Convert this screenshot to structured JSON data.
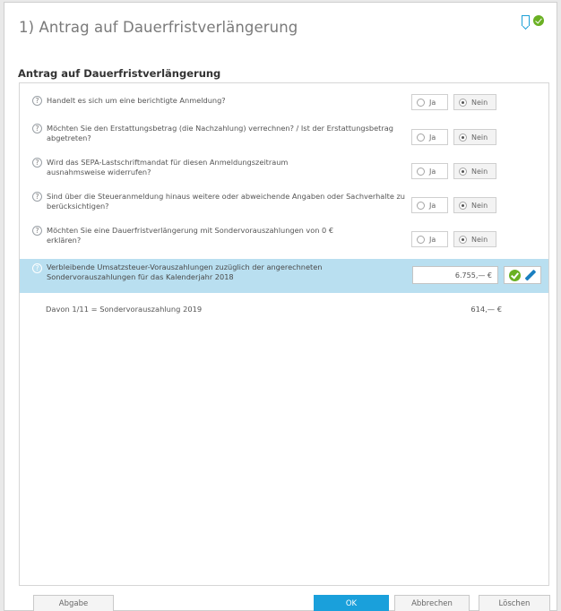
{
  "window": {
    "title": "1) Antrag auf Dauerfristverlängerung",
    "status_icons": [
      "bookmark-icon",
      "check-circle-icon"
    ]
  },
  "section": {
    "heading": "Antrag auf Dauerfristverlängerung"
  },
  "questions": [
    {
      "help": "?",
      "text": "Handelt es sich um eine berichtigte Anmeldung?",
      "yes_label": "Ja",
      "no_label": "Nein",
      "selected": "Nein"
    },
    {
      "help": "?",
      "text": "Möchten Sie den Erstattungsbetrag (die Nachzahlung) verrechnen? / Ist der Erstattungsbetrag abgetreten?",
      "yes_label": "Ja",
      "no_label": "Nein",
      "selected": "Nein"
    },
    {
      "help": "?",
      "text": "Wird das SEPA-Lastschriftmandat für diesen Anmeldungszeitraum ausnahmsweise widerrufen?",
      "yes_label": "Ja",
      "no_label": "Nein",
      "selected": "Nein"
    },
    {
      "help": "?",
      "text": "Sind über die Steueranmeldung hinaus weitere oder abweichende Angaben oder Sachverhalte zu berücksichtigen?",
      "yes_label": "Ja",
      "no_label": "Nein",
      "selected": "Nein"
    },
    {
      "help": "?",
      "text": "Möchten Sie eine Dauerfristverlängerung mit Sondervorauszahlungen von 0 € erklären?",
      "yes_label": "Ja",
      "no_label": "Nein",
      "selected": "Nein"
    }
  ],
  "amount_row": {
    "help": "?",
    "text": "Verbleibende Umsatzsteuer-Vorauszahlungen zuzüglich der angerechneten Sondervorauszahlungen für das Kalenderjahr 2018",
    "value": "6.755,— €"
  },
  "info_row": {
    "label": "Davon 1/11 = Sondervorauszahlung 2019",
    "value": "614,— €"
  },
  "footer": {
    "submit": "Abgabe",
    "ok": "OK",
    "cancel": "Abbrechen",
    "delete": "Löschen"
  }
}
